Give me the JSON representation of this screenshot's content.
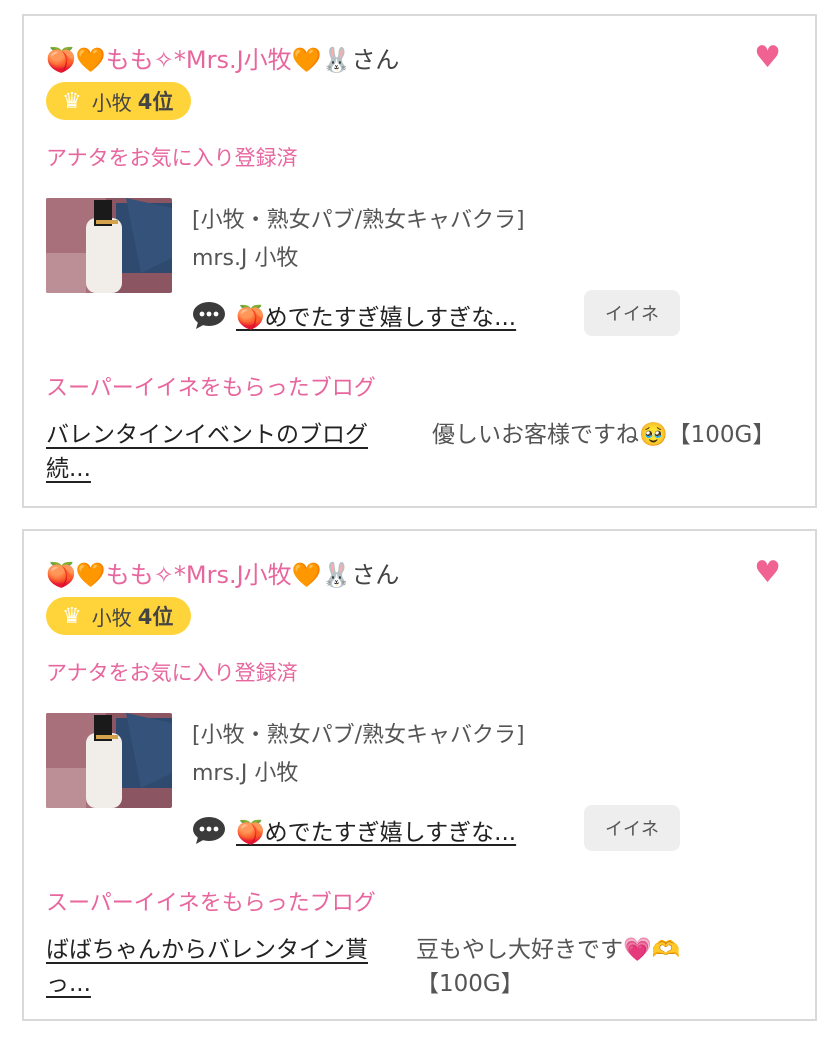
{
  "cards": [
    {
      "user_name": "🍑🧡もも✧*Mrs.J小牧🧡🐰",
      "san": "さん",
      "rank_area": "小牧",
      "rank_num": "4位",
      "fav_status": "アナタをお気に入り登録済",
      "shop_category": "[小牧・熟女パブ/熟女キャバクラ]",
      "shop_name": "mrs.J 小牧",
      "comment": "🍑めでたすぎ嬉しすぎな...",
      "iine_label": "イイネ",
      "super_label": "スーパーイイネをもらったブログ",
      "blog_title": "バレンタインイベントのブログ続...",
      "blog_message": "優しいお客様ですね🥹【100G】"
    },
    {
      "user_name": "🍑🧡もも✧*Mrs.J小牧🧡🐰",
      "san": "さん",
      "rank_area": "小牧",
      "rank_num": "4位",
      "fav_status": "アナタをお気に入り登録済",
      "shop_category": "[小牧・熟女パブ/熟女キャバクラ]",
      "shop_name": "mrs.J 小牧",
      "comment": "🍑めでたすぎ嬉しすぎな...",
      "iine_label": "イイネ",
      "super_label": "スーパーイイネをもらったブログ",
      "blog_title": "ばばちゃんからバレンタイン貰っ...",
      "blog_message": "豆もやし大好きです💗🫶【100G】"
    }
  ],
  "icons": {
    "heart": "heart-icon",
    "crown": "crown-icon",
    "comment": "speech-bubble-icon"
  },
  "colors": {
    "accent_pink": "#e8669e",
    "heart_pink": "#f06292",
    "rank_badge": "#ffd43a",
    "border": "#d9d9d9"
  }
}
